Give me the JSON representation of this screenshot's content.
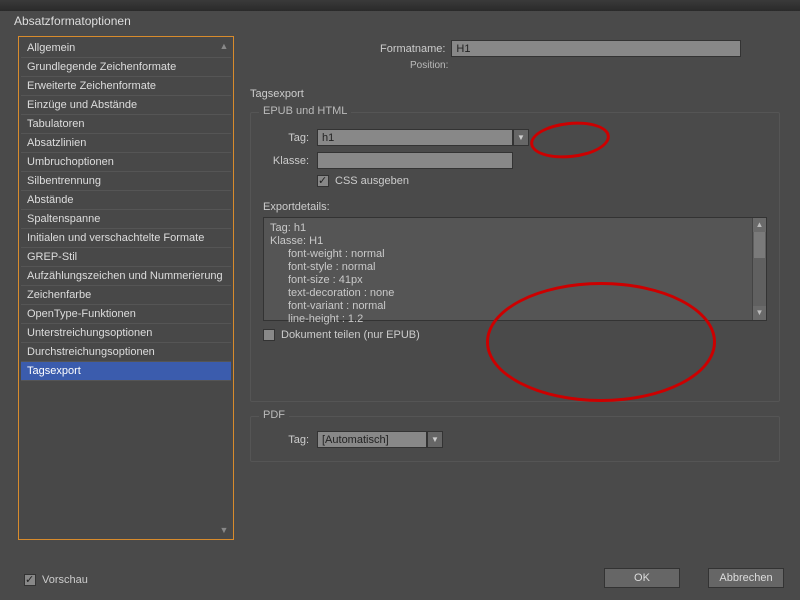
{
  "window": {
    "title": "Absatzformatoptionen"
  },
  "sidebar": {
    "items": [
      "Allgemein",
      "Grundlegende Zeichenformate",
      "Erweiterte Zeichenformate",
      "Einzüge und Abstände",
      "Tabulatoren",
      "Absatzlinien",
      "Umbruchoptionen",
      "Silbentrennung",
      "Abstände",
      "Spaltenspanne",
      "Initialen und verschachtelte Formate",
      "GREP-Stil",
      "Aufzählungszeichen und Nummerierung",
      "Zeichenfarbe",
      "OpenType-Funktionen",
      "Unterstreichungsoptionen",
      "Durchstreichungsoptionen",
      "Tagsexport"
    ],
    "selectedIndex": 17
  },
  "header": {
    "formatname_label": "Formatname:",
    "formatname_value": "H1",
    "position_label": "Position:"
  },
  "section": {
    "title": "Tagsexport"
  },
  "epub": {
    "legend": "EPUB und HTML",
    "tag_label": "Tag:",
    "tag_value": "h1",
    "klasse_label": "Klasse:",
    "klasse_value": "",
    "css_label": "CSS ausgeben",
    "export_label": "Exportdetails:",
    "details": {
      "l1": "Tag: h1",
      "l2": "Klasse: H1",
      "l3": "font-weight : normal",
      "l4": "font-style : normal",
      "l5": "font-size : 41px",
      "l6": "text-decoration : none",
      "l7": "font-variant : normal",
      "l8": "line-height : 1.2"
    },
    "docteilen_label": "Dokument teilen (nur EPUB)"
  },
  "pdf": {
    "legend": "PDF",
    "tag_label": "Tag:",
    "tag_value": "[Automatisch]"
  },
  "footer": {
    "vorschau_label": "Vorschau",
    "ok_label": "OK",
    "cancel_label": "Abbrechen"
  }
}
